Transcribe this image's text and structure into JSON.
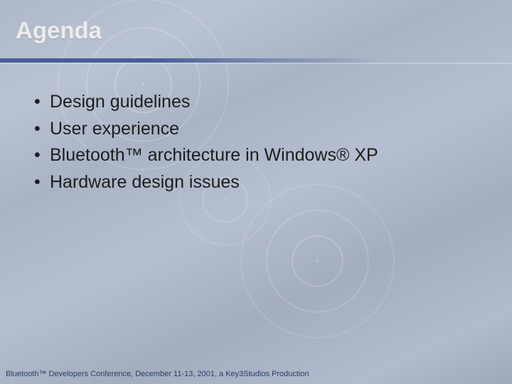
{
  "slide": {
    "title": "Agenda",
    "bullets": [
      "Design guidelines",
      "User experience",
      "Bluetooth™ architecture in Windows® XP",
      "Hardware design issues"
    ],
    "footer": "Bluetooth™ Developers Conference, December 11-13, 2001, a Key3Studios Production"
  }
}
